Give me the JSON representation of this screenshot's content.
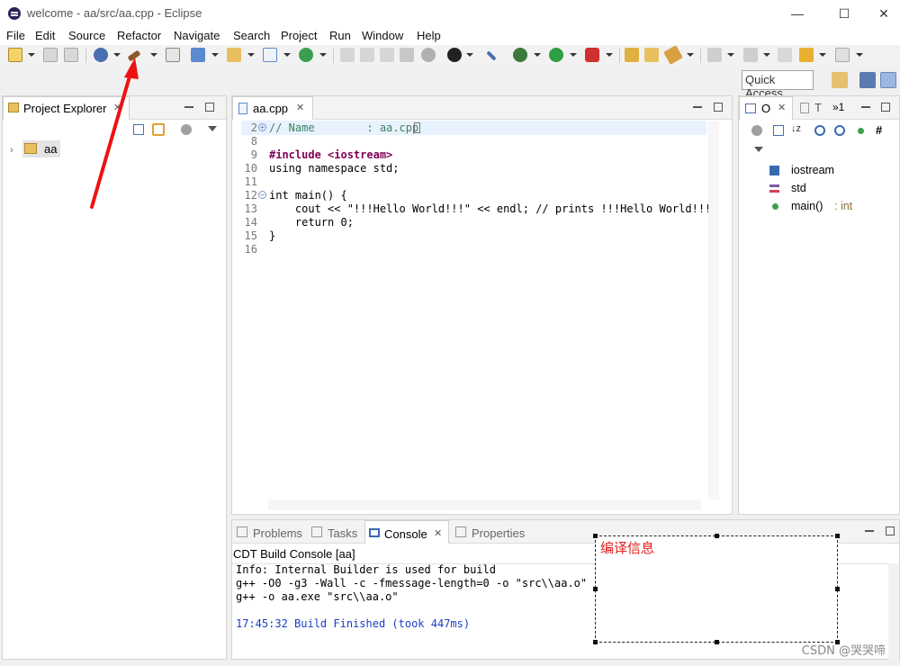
{
  "window": {
    "title": "welcome - aa/src/aa.cpp - Eclipse",
    "minimize": "—",
    "maximize": "☐",
    "close": "✕"
  },
  "menu": [
    "File",
    "Edit",
    "Source",
    "Refactor",
    "Navigate",
    "Search",
    "Project",
    "Run",
    "Window",
    "Help"
  ],
  "toolbar": {
    "quick_access": "Quick Access",
    "icons": [
      "new-icon",
      "save-icon",
      "save-all-icon",
      "build-icon",
      "hammer-build-icon",
      "debug-build-icon",
      "new-cpp-project-icon",
      "new-folder-icon",
      "new-class-icon",
      "refresh-icon",
      "run-icon",
      "debug-icon",
      "back-icon",
      "forward-icon"
    ]
  },
  "project_explorer": {
    "tab_label": "Project Explorer",
    "items": [
      {
        "label": "aa",
        "icon": "project-folder-icon"
      }
    ]
  },
  "editor": {
    "tab_label": "aa.cpp",
    "lines": [
      {
        "n": "2",
        "text": "// Name        : aa.cpp"
      },
      {
        "n": "8",
        "text": ""
      },
      {
        "n": "9",
        "text": "#include <iostream>"
      },
      {
        "n": "10",
        "text": "using namespace std;"
      },
      {
        "n": "11",
        "text": ""
      },
      {
        "n": "12",
        "text": "int main() {"
      },
      {
        "n": "13",
        "text": "    cout << \"!!!Hello World!!!\" << endl; // prints !!!Hello World!!!"
      },
      {
        "n": "14",
        "text": "    return 0;"
      },
      {
        "n": "15",
        "text": "}"
      },
      {
        "n": "16",
        "text": ""
      }
    ]
  },
  "outline": {
    "tab_label": "O",
    "tab2_label": "T",
    "overflow_label": "»1",
    "items": [
      {
        "label": "iostream",
        "type": "",
        "icon": "include-icon"
      },
      {
        "label": "std",
        "type": "",
        "icon": "namespace-icon"
      },
      {
        "label": "main()",
        "type": " : int",
        "icon": "function-icon"
      }
    ]
  },
  "console": {
    "tabs": [
      "Problems",
      "Tasks",
      "Console",
      "Properties"
    ],
    "active_tab": "Console",
    "header": "CDT Build Console [aa]",
    "lines": [
      "Info: Internal Builder is used for build",
      "g++ -O0 -g3 -Wall -c -fmessage-length=0 -o \"src\\\\aa.o\" \"..",
      "g++ -o aa.exe \"src\\\\aa.o\"",
      "",
      "17:45:32 Build Finished (took 447ms)"
    ]
  },
  "annotation": {
    "text": "编译信息",
    "color": "#e02020"
  },
  "watermark": "CSDN @哭哭啼"
}
